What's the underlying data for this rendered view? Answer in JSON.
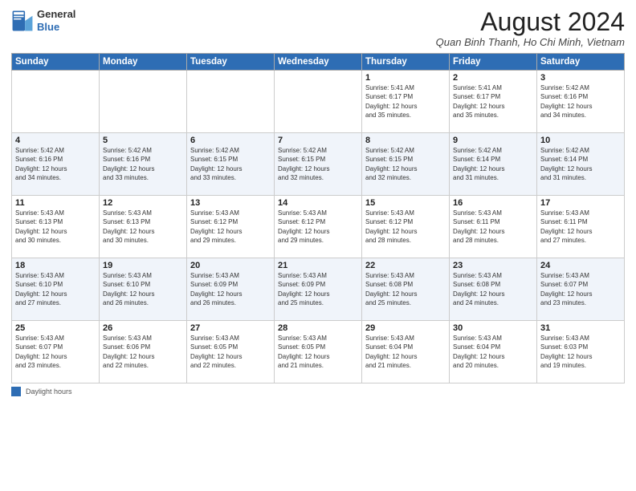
{
  "header": {
    "logo_line1": "General",
    "logo_line2": "Blue",
    "title": "August 2024",
    "location": "Quan Binh Thanh, Ho Chi Minh, Vietnam"
  },
  "days_of_week": [
    "Sunday",
    "Monday",
    "Tuesday",
    "Wednesday",
    "Thursday",
    "Friday",
    "Saturday"
  ],
  "weeks": [
    [
      {
        "day": "",
        "info": ""
      },
      {
        "day": "",
        "info": ""
      },
      {
        "day": "",
        "info": ""
      },
      {
        "day": "",
        "info": ""
      },
      {
        "day": "1",
        "info": "Sunrise: 5:41 AM\nSunset: 6:17 PM\nDaylight: 12 hours\nand 35 minutes."
      },
      {
        "day": "2",
        "info": "Sunrise: 5:41 AM\nSunset: 6:17 PM\nDaylight: 12 hours\nand 35 minutes."
      },
      {
        "day": "3",
        "info": "Sunrise: 5:42 AM\nSunset: 6:16 PM\nDaylight: 12 hours\nand 34 minutes."
      }
    ],
    [
      {
        "day": "4",
        "info": "Sunrise: 5:42 AM\nSunset: 6:16 PM\nDaylight: 12 hours\nand 34 minutes."
      },
      {
        "day": "5",
        "info": "Sunrise: 5:42 AM\nSunset: 6:16 PM\nDaylight: 12 hours\nand 33 minutes."
      },
      {
        "day": "6",
        "info": "Sunrise: 5:42 AM\nSunset: 6:15 PM\nDaylight: 12 hours\nand 33 minutes."
      },
      {
        "day": "7",
        "info": "Sunrise: 5:42 AM\nSunset: 6:15 PM\nDaylight: 12 hours\nand 32 minutes."
      },
      {
        "day": "8",
        "info": "Sunrise: 5:42 AM\nSunset: 6:15 PM\nDaylight: 12 hours\nand 32 minutes."
      },
      {
        "day": "9",
        "info": "Sunrise: 5:42 AM\nSunset: 6:14 PM\nDaylight: 12 hours\nand 31 minutes."
      },
      {
        "day": "10",
        "info": "Sunrise: 5:42 AM\nSunset: 6:14 PM\nDaylight: 12 hours\nand 31 minutes."
      }
    ],
    [
      {
        "day": "11",
        "info": "Sunrise: 5:43 AM\nSunset: 6:13 PM\nDaylight: 12 hours\nand 30 minutes."
      },
      {
        "day": "12",
        "info": "Sunrise: 5:43 AM\nSunset: 6:13 PM\nDaylight: 12 hours\nand 30 minutes."
      },
      {
        "day": "13",
        "info": "Sunrise: 5:43 AM\nSunset: 6:12 PM\nDaylight: 12 hours\nand 29 minutes."
      },
      {
        "day": "14",
        "info": "Sunrise: 5:43 AM\nSunset: 6:12 PM\nDaylight: 12 hours\nand 29 minutes."
      },
      {
        "day": "15",
        "info": "Sunrise: 5:43 AM\nSunset: 6:12 PM\nDaylight: 12 hours\nand 28 minutes."
      },
      {
        "day": "16",
        "info": "Sunrise: 5:43 AM\nSunset: 6:11 PM\nDaylight: 12 hours\nand 28 minutes."
      },
      {
        "day": "17",
        "info": "Sunrise: 5:43 AM\nSunset: 6:11 PM\nDaylight: 12 hours\nand 27 minutes."
      }
    ],
    [
      {
        "day": "18",
        "info": "Sunrise: 5:43 AM\nSunset: 6:10 PM\nDaylight: 12 hours\nand 27 minutes."
      },
      {
        "day": "19",
        "info": "Sunrise: 5:43 AM\nSunset: 6:10 PM\nDaylight: 12 hours\nand 26 minutes."
      },
      {
        "day": "20",
        "info": "Sunrise: 5:43 AM\nSunset: 6:09 PM\nDaylight: 12 hours\nand 26 minutes."
      },
      {
        "day": "21",
        "info": "Sunrise: 5:43 AM\nSunset: 6:09 PM\nDaylight: 12 hours\nand 25 minutes."
      },
      {
        "day": "22",
        "info": "Sunrise: 5:43 AM\nSunset: 6:08 PM\nDaylight: 12 hours\nand 25 minutes."
      },
      {
        "day": "23",
        "info": "Sunrise: 5:43 AM\nSunset: 6:08 PM\nDaylight: 12 hours\nand 24 minutes."
      },
      {
        "day": "24",
        "info": "Sunrise: 5:43 AM\nSunset: 6:07 PM\nDaylight: 12 hours\nand 23 minutes."
      }
    ],
    [
      {
        "day": "25",
        "info": "Sunrise: 5:43 AM\nSunset: 6:07 PM\nDaylight: 12 hours\nand 23 minutes."
      },
      {
        "day": "26",
        "info": "Sunrise: 5:43 AM\nSunset: 6:06 PM\nDaylight: 12 hours\nand 22 minutes."
      },
      {
        "day": "27",
        "info": "Sunrise: 5:43 AM\nSunset: 6:05 PM\nDaylight: 12 hours\nand 22 minutes."
      },
      {
        "day": "28",
        "info": "Sunrise: 5:43 AM\nSunset: 6:05 PM\nDaylight: 12 hours\nand 21 minutes."
      },
      {
        "day": "29",
        "info": "Sunrise: 5:43 AM\nSunset: 6:04 PM\nDaylight: 12 hours\nand 21 minutes."
      },
      {
        "day": "30",
        "info": "Sunrise: 5:43 AM\nSunset: 6:04 PM\nDaylight: 12 hours\nand 20 minutes."
      },
      {
        "day": "31",
        "info": "Sunrise: 5:43 AM\nSunset: 6:03 PM\nDaylight: 12 hours\nand 19 minutes."
      }
    ]
  ],
  "footer": {
    "daylight_label": "Daylight hours"
  }
}
